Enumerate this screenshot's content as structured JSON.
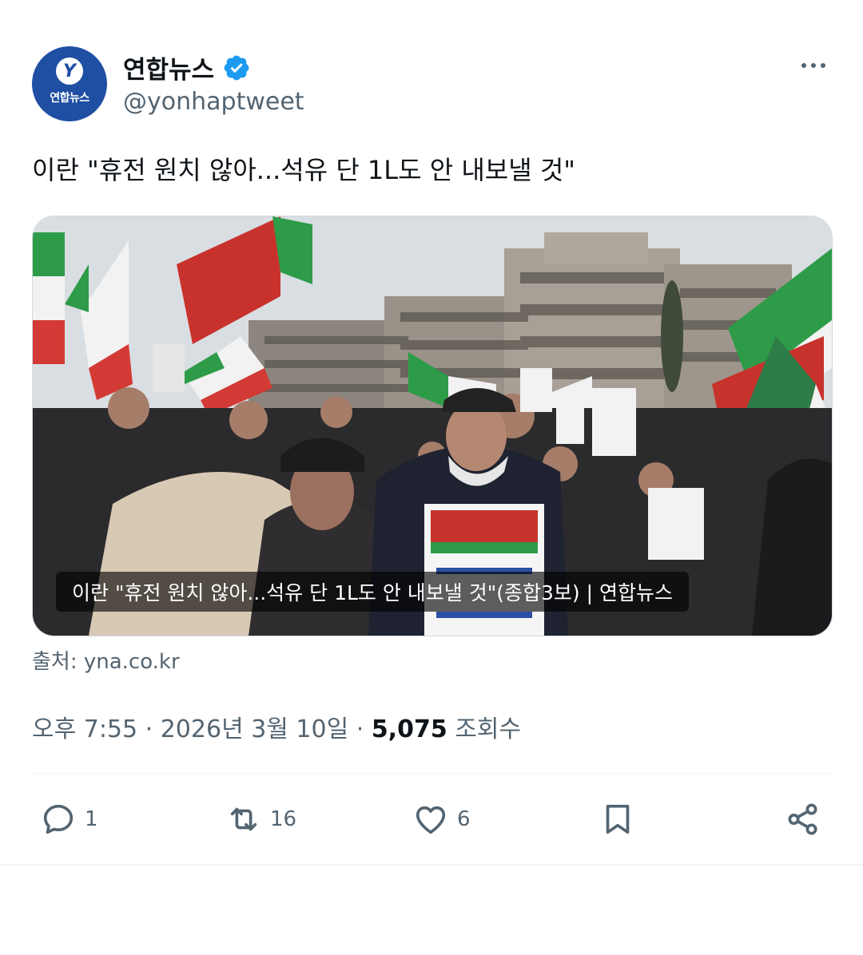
{
  "account": {
    "name": "연합뉴스",
    "handle": "@yonhaptweet",
    "avatar_text": "연합뉴스",
    "brand_color": "#1f4fa3",
    "verified_color": "#1d9bf0"
  },
  "tweet": {
    "text": "이란 \"휴전 원치 않아...석유 단 1L도 안 내보낼 것\""
  },
  "card": {
    "caption": "이란 \"휴전 원치 않아...석유 단 1L도 안 내보낼 것\"(종합3보) | 연합뉴스",
    "source": "출처: yna.co.kr",
    "image_description_icon": "photo-protest-crowd"
  },
  "meta": {
    "time": "오후 7:55",
    "separator": " · ",
    "date": "2026년 3월 10일",
    "views_count": "5,075",
    "views_label": "조회수"
  },
  "actions": {
    "reply_count": "1",
    "retweet_count": "16",
    "like_count": "6"
  },
  "icons": {
    "more": "more-dots-icon",
    "verified": "verified-badge-icon",
    "reply": "reply-icon",
    "retweet": "retweet-icon",
    "like": "heart-icon",
    "bookmark": "bookmark-icon",
    "share": "share-icon"
  }
}
